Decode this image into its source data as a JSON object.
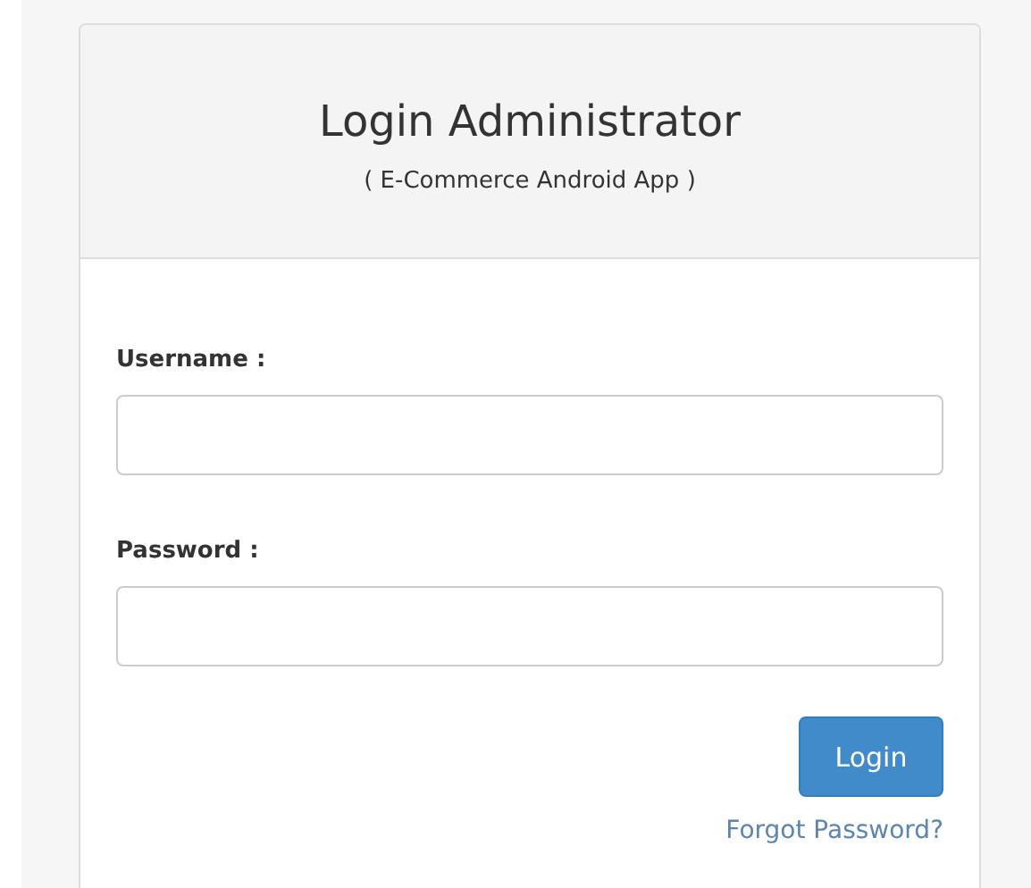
{
  "header": {
    "title": "Login Administrator",
    "subtitle": "( E-Commerce Android App )"
  },
  "fields": [
    {
      "label": "Username :"
    },
    {
      "label": "Password :"
    }
  ],
  "login_button": "Login",
  "forgot_link": "Forgot Password?"
}
